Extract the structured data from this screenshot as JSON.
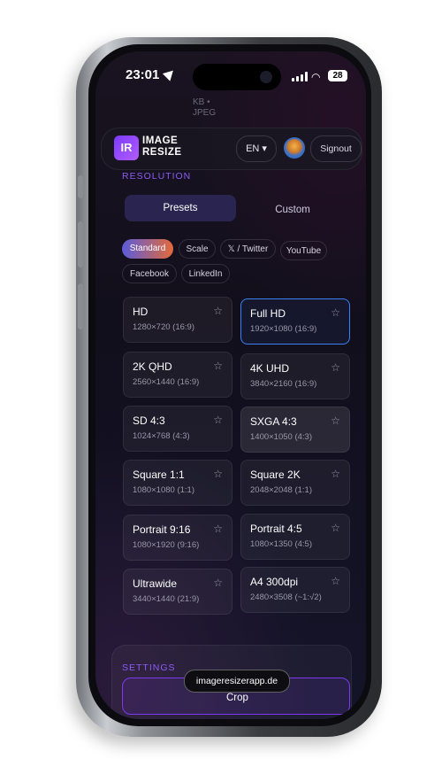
{
  "status_bar": {
    "time": "23:01",
    "battery": "28"
  },
  "ghost_text": {
    "line1": "KB •",
    "line2": "JPEG"
  },
  "header": {
    "logo_mark": "IR",
    "logo_line1": "IMAGE",
    "logo_line2": "RESIZE",
    "language": "EN ▾",
    "signout": "Signout"
  },
  "resolution": {
    "section_title": "RESOLUTION",
    "tabs": [
      {
        "label": "Presets",
        "active": true
      },
      {
        "label": "Custom",
        "active": false
      }
    ],
    "chips": [
      {
        "label": "Standard",
        "active": true
      },
      {
        "label": "Scale"
      },
      {
        "label": "𝕏 / Twitter"
      },
      {
        "label": "YouTube"
      },
      {
        "label": "Facebook"
      },
      {
        "label": "LinkedIn"
      }
    ],
    "presets": [
      {
        "title": "HD",
        "sub": "1280×720 (16:9)"
      },
      {
        "title": "Full HD",
        "sub": "1920×1080 (16:9)",
        "selected": true
      },
      {
        "title": "2K QHD",
        "sub": "2560×1440 (16:9)"
      },
      {
        "title": "4K UHD",
        "sub": "3840×2160 (16:9)"
      },
      {
        "title": "SD 4:3",
        "sub": "1024×768 (4:3)"
      },
      {
        "title": "SXGA 4:3",
        "sub": "1400×1050 (4:3)"
      },
      {
        "title": "Square 1:1",
        "sub": "1080×1080 (1:1)"
      },
      {
        "title": "Square 2K",
        "sub": "2048×2048 (1:1)"
      },
      {
        "title": "Portrait 9:16",
        "sub": "1080×1920 (9:16)"
      },
      {
        "title": "Portrait 4:5",
        "sub": "1080×1350 (4:5)"
      },
      {
        "title": "Ultrawide",
        "sub": "3440×1440 (21:9)"
      },
      {
        "title": "A4 300dpi",
        "sub": "2480×3508 (~1:√2)"
      }
    ]
  },
  "settings": {
    "section_title": "SETTINGS",
    "crop_label": "Crop"
  },
  "url_pill": "imageresizerapp.de",
  "colors": {
    "accent": "#8b5cf6",
    "selected_border": "#3b82f6",
    "background": "#14121f"
  }
}
